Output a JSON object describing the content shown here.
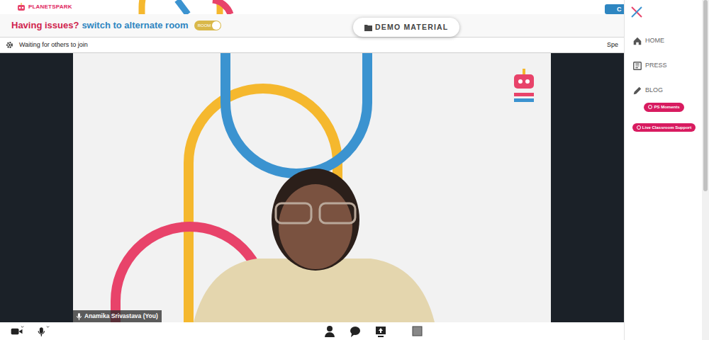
{
  "header": {
    "logo_part1": "PLANET",
    "logo_part2": "SPARK",
    "issue_text": "Having issues?",
    "switch_text": "switch to alternate room",
    "toggle": {
      "label": "ROOM",
      "on": true
    },
    "demo_button": "DEMO MATERIAL",
    "corner_tab": "C"
  },
  "status_bar": {
    "text": "Waiting for others to join",
    "right_text": "Spe"
  },
  "video": {
    "participant": "Anamika Srivastava (You)"
  },
  "sidebar": {
    "items": [
      {
        "label": "HOME"
      },
      {
        "label": "PRESS"
      },
      {
        "label": "BLOG"
      }
    ],
    "pills": [
      {
        "label": "PS Moments"
      },
      {
        "label": "Live Classroom Support"
      }
    ]
  }
}
